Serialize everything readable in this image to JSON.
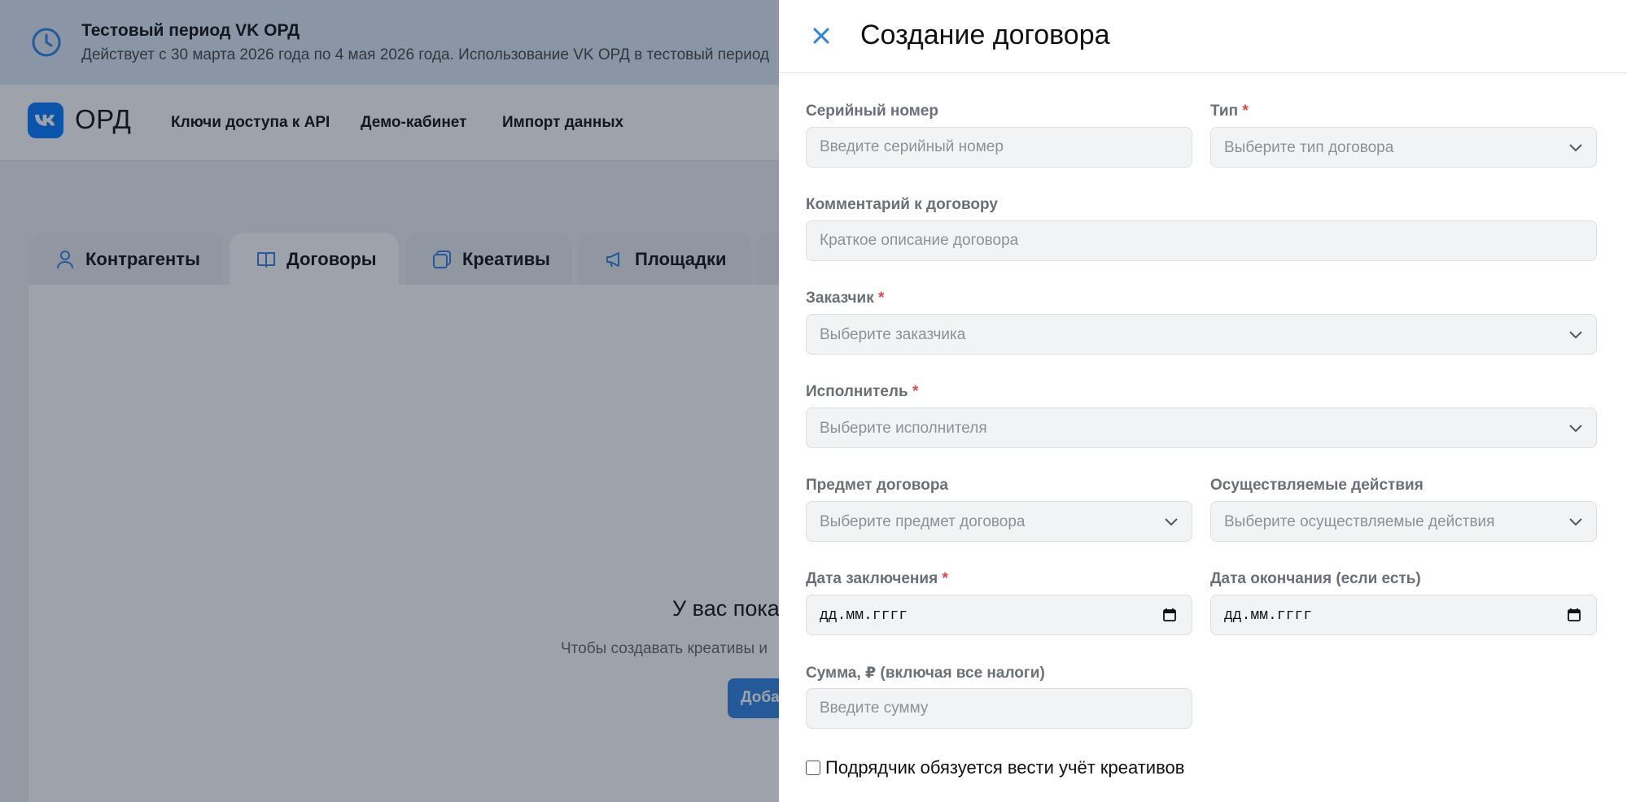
{
  "banner": {
    "title": "Тестовый период VK ОРД",
    "text": "Действует с 30 марта 2026 года по 4 мая 2026 года. Использование VK ОРД в тестовый период"
  },
  "header": {
    "logo_text": "ОРД",
    "nav": [
      "Ключи доступа к API",
      "Демо-кабинет",
      "Импорт данных"
    ]
  },
  "tabs": [
    {
      "label": "Контрагенты",
      "icon": "user-icon"
    },
    {
      "label": "Договоры",
      "icon": "book-icon"
    },
    {
      "label": "Креативы",
      "icon": "layers-icon"
    },
    {
      "label": "Площадки",
      "icon": "megaphone-icon"
    }
  ],
  "empty_state": {
    "title": "У вас пока",
    "text": "Чтобы создавать креативы и",
    "button": "Доба"
  },
  "drawer": {
    "title": "Создание договора",
    "serial": {
      "label": "Серийный номер",
      "placeholder": "Введите серийный номер"
    },
    "type": {
      "label": "Тип",
      "placeholder": "Выберите тип договора"
    },
    "comment": {
      "label": "Комментарий к договору",
      "placeholder": "Краткое описание договора"
    },
    "customer": {
      "label": "Заказчик",
      "placeholder": "Выберите заказчика"
    },
    "executor": {
      "label": "Исполнитель",
      "placeholder": "Выберите исполнителя"
    },
    "subject": {
      "label": "Предмет договора",
      "placeholder": "Выберите предмет договора"
    },
    "actions": {
      "label": "Осуществляемые действия",
      "placeholder": "Выберите осуществляемые действия"
    },
    "date_start": {
      "label": "Дата заключения",
      "placeholder": "дд.мм.гггг"
    },
    "date_end": {
      "label": "Дата окончания (если есть)",
      "placeholder": "дд.мм.гггг"
    },
    "amount": {
      "label": "Сумма, ₽ (включая все налоги)",
      "placeholder": "Введите сумму"
    },
    "checkbox_label": "Подрядчик обязуется вести учёт креативов",
    "required_mark": "*"
  },
  "colors": {
    "accent": "#2d81e0",
    "required": "#e64646",
    "vk_blue": "#0077ff"
  }
}
